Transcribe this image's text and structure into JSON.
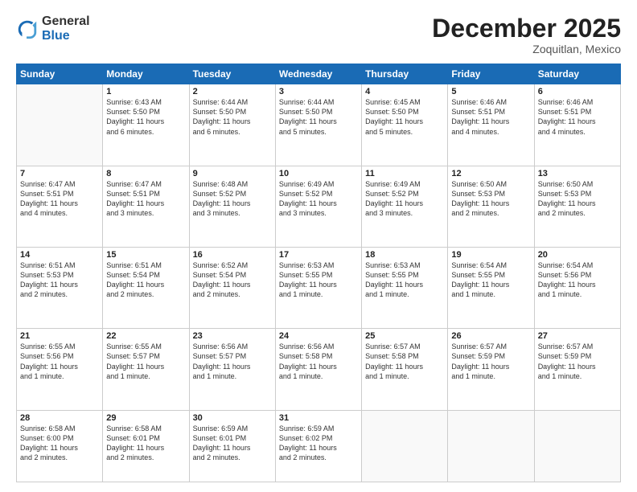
{
  "logo": {
    "general": "General",
    "blue": "Blue"
  },
  "header": {
    "month": "December 2025",
    "location": "Zoquitlan, Mexico"
  },
  "days_of_week": [
    "Sunday",
    "Monday",
    "Tuesday",
    "Wednesday",
    "Thursday",
    "Friday",
    "Saturday"
  ],
  "weeks": [
    [
      {
        "day": "",
        "info": ""
      },
      {
        "day": "1",
        "info": "Sunrise: 6:43 AM\nSunset: 5:50 PM\nDaylight: 11 hours\nand 6 minutes."
      },
      {
        "day": "2",
        "info": "Sunrise: 6:44 AM\nSunset: 5:50 PM\nDaylight: 11 hours\nand 6 minutes."
      },
      {
        "day": "3",
        "info": "Sunrise: 6:44 AM\nSunset: 5:50 PM\nDaylight: 11 hours\nand 5 minutes."
      },
      {
        "day": "4",
        "info": "Sunrise: 6:45 AM\nSunset: 5:50 PM\nDaylight: 11 hours\nand 5 minutes."
      },
      {
        "day": "5",
        "info": "Sunrise: 6:46 AM\nSunset: 5:51 PM\nDaylight: 11 hours\nand 4 minutes."
      },
      {
        "day": "6",
        "info": "Sunrise: 6:46 AM\nSunset: 5:51 PM\nDaylight: 11 hours\nand 4 minutes."
      }
    ],
    [
      {
        "day": "7",
        "info": "Sunrise: 6:47 AM\nSunset: 5:51 PM\nDaylight: 11 hours\nand 4 minutes."
      },
      {
        "day": "8",
        "info": "Sunrise: 6:47 AM\nSunset: 5:51 PM\nDaylight: 11 hours\nand 3 minutes."
      },
      {
        "day": "9",
        "info": "Sunrise: 6:48 AM\nSunset: 5:52 PM\nDaylight: 11 hours\nand 3 minutes."
      },
      {
        "day": "10",
        "info": "Sunrise: 6:49 AM\nSunset: 5:52 PM\nDaylight: 11 hours\nand 3 minutes."
      },
      {
        "day": "11",
        "info": "Sunrise: 6:49 AM\nSunset: 5:52 PM\nDaylight: 11 hours\nand 3 minutes."
      },
      {
        "day": "12",
        "info": "Sunrise: 6:50 AM\nSunset: 5:53 PM\nDaylight: 11 hours\nand 2 minutes."
      },
      {
        "day": "13",
        "info": "Sunrise: 6:50 AM\nSunset: 5:53 PM\nDaylight: 11 hours\nand 2 minutes."
      }
    ],
    [
      {
        "day": "14",
        "info": "Sunrise: 6:51 AM\nSunset: 5:53 PM\nDaylight: 11 hours\nand 2 minutes."
      },
      {
        "day": "15",
        "info": "Sunrise: 6:51 AM\nSunset: 5:54 PM\nDaylight: 11 hours\nand 2 minutes."
      },
      {
        "day": "16",
        "info": "Sunrise: 6:52 AM\nSunset: 5:54 PM\nDaylight: 11 hours\nand 2 minutes."
      },
      {
        "day": "17",
        "info": "Sunrise: 6:53 AM\nSunset: 5:55 PM\nDaylight: 11 hours\nand 1 minute."
      },
      {
        "day": "18",
        "info": "Sunrise: 6:53 AM\nSunset: 5:55 PM\nDaylight: 11 hours\nand 1 minute."
      },
      {
        "day": "19",
        "info": "Sunrise: 6:54 AM\nSunset: 5:55 PM\nDaylight: 11 hours\nand 1 minute."
      },
      {
        "day": "20",
        "info": "Sunrise: 6:54 AM\nSunset: 5:56 PM\nDaylight: 11 hours\nand 1 minute."
      }
    ],
    [
      {
        "day": "21",
        "info": "Sunrise: 6:55 AM\nSunset: 5:56 PM\nDaylight: 11 hours\nand 1 minute."
      },
      {
        "day": "22",
        "info": "Sunrise: 6:55 AM\nSunset: 5:57 PM\nDaylight: 11 hours\nand 1 minute."
      },
      {
        "day": "23",
        "info": "Sunrise: 6:56 AM\nSunset: 5:57 PM\nDaylight: 11 hours\nand 1 minute."
      },
      {
        "day": "24",
        "info": "Sunrise: 6:56 AM\nSunset: 5:58 PM\nDaylight: 11 hours\nand 1 minute."
      },
      {
        "day": "25",
        "info": "Sunrise: 6:57 AM\nSunset: 5:58 PM\nDaylight: 11 hours\nand 1 minute."
      },
      {
        "day": "26",
        "info": "Sunrise: 6:57 AM\nSunset: 5:59 PM\nDaylight: 11 hours\nand 1 minute."
      },
      {
        "day": "27",
        "info": "Sunrise: 6:57 AM\nSunset: 5:59 PM\nDaylight: 11 hours\nand 1 minute."
      }
    ],
    [
      {
        "day": "28",
        "info": "Sunrise: 6:58 AM\nSunset: 6:00 PM\nDaylight: 11 hours\nand 2 minutes."
      },
      {
        "day": "29",
        "info": "Sunrise: 6:58 AM\nSunset: 6:01 PM\nDaylight: 11 hours\nand 2 minutes."
      },
      {
        "day": "30",
        "info": "Sunrise: 6:59 AM\nSunset: 6:01 PM\nDaylight: 11 hours\nand 2 minutes."
      },
      {
        "day": "31",
        "info": "Sunrise: 6:59 AM\nSunset: 6:02 PM\nDaylight: 11 hours\nand 2 minutes."
      },
      {
        "day": "",
        "info": ""
      },
      {
        "day": "",
        "info": ""
      },
      {
        "day": "",
        "info": ""
      }
    ]
  ]
}
